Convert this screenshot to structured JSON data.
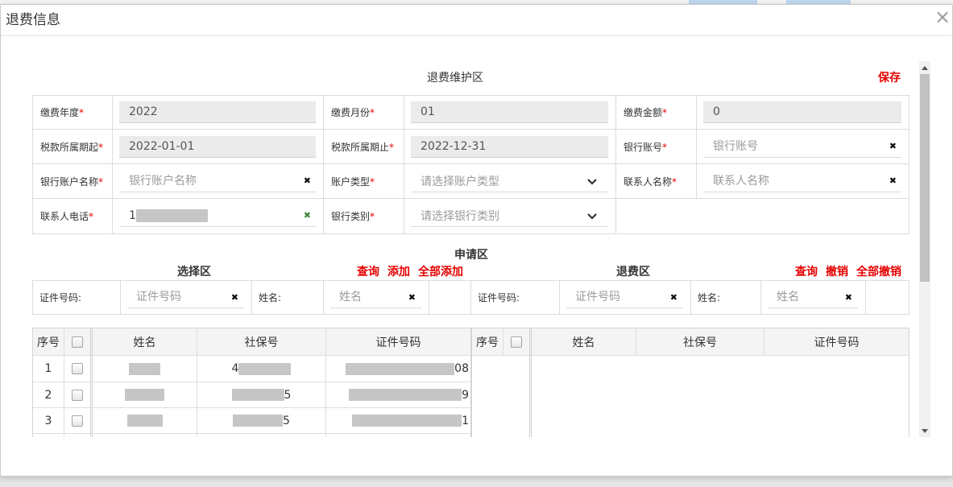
{
  "dialog": {
    "title": "退费信息",
    "close_glyph": "×"
  },
  "theme": {
    "link_color": "#e60000",
    "required_color": "#e60000",
    "valid_icon_color": "#3d8b37",
    "readonly_bg": "#ebebeb",
    "border_color": "#dcdcdc",
    "grid_header_bg": "#f4f4f4",
    "scrollbar_thumb": "#c1c1c1"
  },
  "icons": {
    "clear_glyph": "✖",
    "close": "close-icon",
    "clear": "clear-icon",
    "dropdown": "chevron-down-icon"
  },
  "maintenance": {
    "title": "退费维护区",
    "save_label": "保存",
    "required_mark": "*",
    "payment_year": {
      "label": "缴费年度",
      "value": "2022"
    },
    "payment_month": {
      "label": "缴费月份",
      "value": "01"
    },
    "payment_amount": {
      "label": "缴费金额",
      "value": "0"
    },
    "tax_period_start": {
      "label": "税款所属期起",
      "value": "2022-01-01"
    },
    "tax_period_end": {
      "label": "税款所属期止",
      "value": "2022-12-31"
    },
    "bank_account": {
      "label": "银行账号",
      "placeholder": "银行账号"
    },
    "bank_account_name": {
      "label": "银行账户名称",
      "placeholder": "银行账户名称"
    },
    "account_type": {
      "label": "账户类型",
      "placeholder": "请选择账户类型"
    },
    "contact_name": {
      "label": "联系人名称",
      "placeholder": "联系人名称"
    },
    "contact_phone": {
      "label": "联系人电话",
      "value_prefix": "1",
      "redacted": true
    },
    "bank_category": {
      "label": "银行类别",
      "placeholder": "请选择银行类别"
    }
  },
  "application": {
    "title": "申请区",
    "selection": {
      "title": "选择区",
      "actions": {
        "query": "查询",
        "add": "添加",
        "add_all": "全部添加"
      },
      "search": {
        "id_label": "证件号码:",
        "id_placeholder": "证件号码",
        "name_label": "姓名:",
        "name_placeholder": "姓名"
      },
      "grid": {
        "columns": {
          "index": "序号",
          "name": "姓名",
          "ssn": "社保号",
          "id_no": "证件号码"
        },
        "select_all_checked": false,
        "rows": [
          {
            "index": "1",
            "checked": false,
            "name_redacted": true,
            "ssn_prefix": "4",
            "id_no_suffix": "08"
          },
          {
            "index": "2",
            "checked": false,
            "name_redacted": true,
            "ssn_suffix": "5",
            "id_no_suffix": "9"
          },
          {
            "index": "3",
            "checked": false,
            "name_redacted": true,
            "ssn_suffix": "5",
            "id_no_suffix": "1"
          }
        ]
      }
    },
    "refund": {
      "title": "退费区",
      "actions": {
        "query": "查询",
        "revoke": "撤销",
        "revoke_all": "全部撤销"
      },
      "search": {
        "id_label": "证件号码:",
        "id_placeholder": "证件号码",
        "name_label": "姓名:",
        "name_placeholder": "姓名"
      },
      "grid": {
        "columns": {
          "index": "序号",
          "name": "姓名",
          "ssn": "社保号",
          "id_no": "证件号码"
        },
        "select_all_checked": false,
        "rows": []
      }
    }
  }
}
